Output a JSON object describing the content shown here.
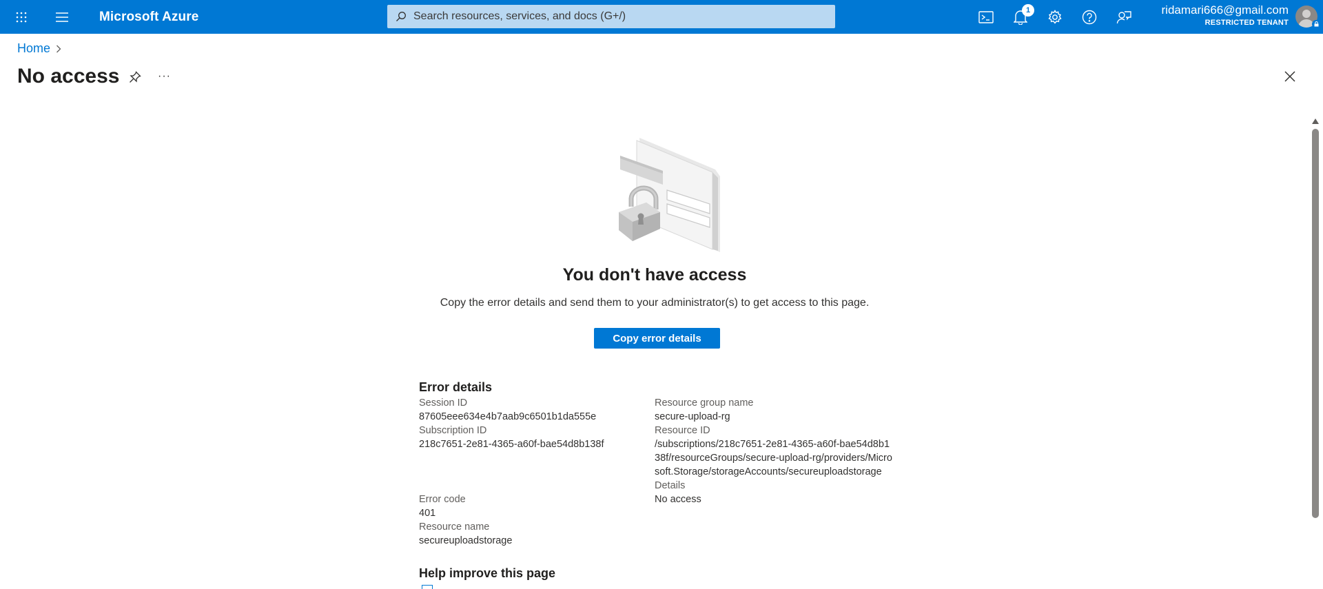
{
  "topbar": {
    "brand": "Microsoft Azure",
    "search_placeholder": "Search resources, services, and docs (G+/)",
    "notification_count": "1",
    "user_email": "ridamari666@gmail.com",
    "tenant": "RESTRICTED TENANT",
    "icons": [
      "app-launcher-icon",
      "hamburger-menu-icon",
      "search-icon",
      "cloud-shell-icon",
      "bell-icon",
      "gear-icon",
      "help-icon",
      "feedback-icon",
      "avatar-icon"
    ]
  },
  "breadcrumb": {
    "home": "Home"
  },
  "page": {
    "title": "No access",
    "more": "···"
  },
  "main": {
    "heading": "You don't have access",
    "subtext": "Copy the error details and send them to your administrator(s) to get access to this page.",
    "copy_button": "Copy error details"
  },
  "error_details": {
    "title": "Error details",
    "session_id_label": "Session ID",
    "session_id": "87605eee634e4b7aab9c6501b1da555e",
    "subscription_id_label": "Subscription ID",
    "subscription_id": "218c7651-2e81-4365-a60f-bae54d8b138f",
    "error_code_label": "Error code",
    "error_code": "401",
    "resource_name_label": "Resource name",
    "resource_name": "secureuploadstorage",
    "resource_group_label": "Resource group name",
    "resource_group": "secure-upload-rg",
    "resource_id_label": "Resource ID",
    "resource_id": "/subscriptions/218c7651-2e81-4365-a60f-bae54d8b138f/resourceGroups/secure-upload-rg/providers/Microsoft.Storage/storageAccounts/secureuploadstorage",
    "details_label": "Details",
    "details": "No access"
  },
  "help": {
    "title": "Help improve this page"
  },
  "colors": {
    "accent": "#0078d4",
    "topbar": "#0078d4"
  }
}
